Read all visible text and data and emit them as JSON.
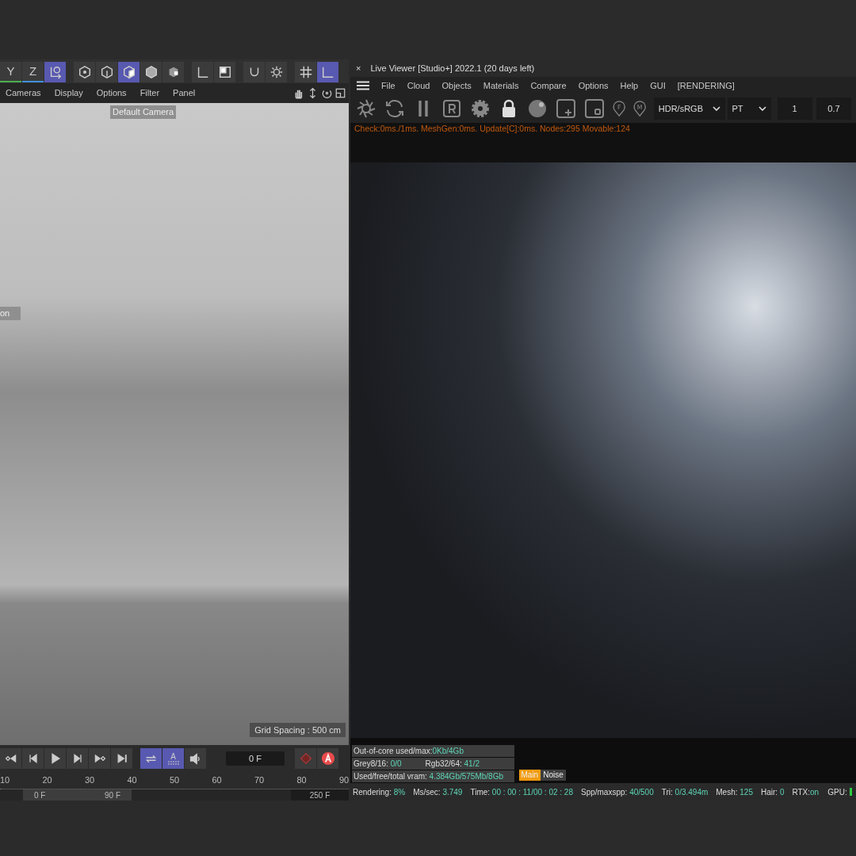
{
  "viewport": {
    "toolbar": [
      {
        "kind": "axis",
        "label": "Y",
        "color": "#4caf50",
        "selected": false
      },
      {
        "kind": "axis",
        "label": "Z",
        "color": "#3f8fd8",
        "selected": false
      },
      {
        "kind": "coords",
        "selected": true
      },
      {
        "kind": "gap"
      },
      {
        "kind": "point",
        "selected": false
      },
      {
        "kind": "edge",
        "selected": false
      },
      {
        "kind": "poly",
        "selected": true
      },
      {
        "kind": "model",
        "selected": false
      },
      {
        "kind": "texture",
        "selected": false
      },
      {
        "kind": "gap"
      },
      {
        "kind": "axis-tool",
        "selected": false
      },
      {
        "kind": "solo",
        "selected": false
      },
      {
        "kind": "gap"
      },
      {
        "kind": "magnet",
        "selected": false
      },
      {
        "kind": "gear",
        "selected": false
      },
      {
        "kind": "gap"
      },
      {
        "kind": "grid",
        "selected": false
      },
      {
        "kind": "blank",
        "selected": true
      }
    ],
    "menu": [
      "Cameras",
      "Display",
      "Options",
      "Filter",
      "Panel"
    ],
    "camera_label": "Default Camera",
    "side_label": "on",
    "grid_spacing": "Grid Spacing : 500 cm"
  },
  "timeline": {
    "transport": [
      {
        "kind": "prev-key"
      },
      {
        "kind": "prev-frame"
      },
      {
        "kind": "play"
      },
      {
        "kind": "next-frame"
      },
      {
        "kind": "next-key"
      },
      {
        "kind": "end"
      }
    ],
    "modes": [
      {
        "kind": "loop",
        "selected": true
      },
      {
        "kind": "autokey",
        "label": "A",
        "selected": true
      },
      {
        "kind": "sound",
        "selected": false
      }
    ],
    "frame": "0 F",
    "ruler": [
      "10",
      "20",
      "30",
      "40",
      "50",
      "60",
      "70",
      "80",
      "90"
    ],
    "range_start": "0 F",
    "range_end": "90 F",
    "end_frame": "250 F"
  },
  "live_viewer": {
    "title": "Live Viewer [Studio+] 2022.1 (20 days left)",
    "close": "×",
    "menu": [
      "File",
      "Cloud",
      "Objects",
      "Materials",
      "Compare",
      "Options",
      "Help",
      "GUI",
      "[RENDERING]"
    ],
    "toolbar": [
      {
        "kind": "aperture"
      },
      {
        "kind": "refresh"
      },
      {
        "kind": "pause"
      },
      {
        "kind": "region"
      },
      {
        "kind": "gear"
      },
      {
        "kind": "lock"
      },
      {
        "kind": "sphere"
      },
      {
        "kind": "add"
      },
      {
        "kind": "small"
      },
      {
        "kind": "pin",
        "label": "F"
      },
      {
        "kind": "pin",
        "label": "M"
      }
    ],
    "tone": "HDR/sRGB",
    "kernel": "PT",
    "field_1": "1",
    "field_2": "0.7",
    "stats_line": "Check:0ms./1ms. MeshGen:0ms. Update[C]:0ms. Nodes:295 Movable:124",
    "memory": [
      [
        {
          "label": "Out-of-core used/max:",
          "value": "0Kb/4Gb"
        }
      ],
      [
        {
          "label": "Grey8/16: ",
          "value": "0/0"
        },
        {
          "label": "Rgb32/64: ",
          "value": "41/2"
        }
      ],
      [
        {
          "label": "Used/free/total vram: ",
          "value": "4.384Gb/575Mb/8Gb"
        }
      ]
    ],
    "passes": [
      {
        "label": "Main",
        "selected": true
      },
      {
        "label": "Noise",
        "selected": false
      }
    ],
    "status": [
      {
        "label": "Rendering: ",
        "value": "8%"
      },
      {
        "label": "Ms/sec: ",
        "value": "3.749"
      },
      {
        "label": "Time: ",
        "value": "00 : 00 : 11/00 : 02 : 28"
      },
      {
        "label": "Spp/maxspp: ",
        "value": "40/500"
      },
      {
        "label": "Tri: ",
        "value": "0/3.494m"
      },
      {
        "label": "Mesh: ",
        "value": "125"
      },
      {
        "label": "Hair: ",
        "value": "0"
      },
      {
        "label": "RTX:",
        "value": "on"
      },
      {
        "label": "GPU:"
      }
    ]
  }
}
